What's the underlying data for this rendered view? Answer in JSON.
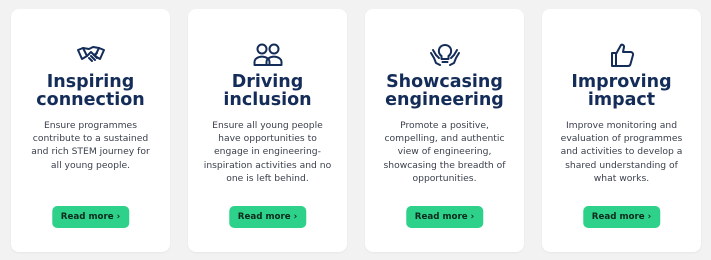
{
  "colors": {
    "background": "#f2f2f3",
    "card": "#ffffff",
    "heading": "#142c58",
    "body_text": "#3a3f4b",
    "button": "#2ed18a"
  },
  "cards": [
    {
      "icon": "handshake-icon",
      "title_line1": "Inspiring",
      "title_line2": "connection",
      "desc_line1": "Ensure programmes",
      "desc_line2": "contribute to a sustained",
      "desc_line3": "and rich STEM journey for",
      "desc_line4": "all young people.",
      "desc_line5": "",
      "button_label": "Read more",
      "button_chevron": "›"
    },
    {
      "icon": "people-icon",
      "title_line1": "Driving",
      "title_line2": "inclusion",
      "desc_line1": "Ensure all young people",
      "desc_line2": "have opportunities to",
      "desc_line3": "engage in engineering-",
      "desc_line4": "inspiration activities and no",
      "desc_line5": "one is left behind.",
      "button_label": "Read more",
      "button_chevron": "›"
    },
    {
      "icon": "lightbulb-hands-icon",
      "title_line1": "Showcasing",
      "title_line2": "engineering",
      "desc_line1": "Promote a positive,",
      "desc_line2": "compelling, and authentic",
      "desc_line3": "view of engineering,",
      "desc_line4": "showcasing the breadth of",
      "desc_line5": "opportunities.",
      "button_label": "Read more",
      "button_chevron": "›"
    },
    {
      "icon": "thumbs-up-icon",
      "title_line1": "Improving",
      "title_line2": "impact",
      "desc_line1": "Improve monitoring and",
      "desc_line2": "evaluation of programmes",
      "desc_line3": "and activities to develop a",
      "desc_line4": "shared understanding of",
      "desc_line5": "what works.",
      "button_label": "Read more",
      "button_chevron": "›"
    }
  ]
}
